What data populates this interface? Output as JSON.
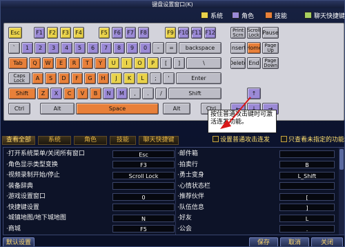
{
  "window": {
    "title": "键盘设置窗口(K)"
  },
  "legend": [
    {
      "label": "系统",
      "color": "#e9d24a"
    },
    {
      "label": "角色",
      "color": "#9b8ad6"
    },
    {
      "label": "技能",
      "color": "#e8803a"
    },
    {
      "label": "聊天快捷键",
      "color": "#a8d060"
    }
  ],
  "keys": [
    {
      "label": "Esc",
      "cat": "sys",
      "row": 0
    },
    {
      "label": "F1",
      "cat": "role",
      "row": 0
    },
    {
      "label": "F2",
      "cat": "sys",
      "row": 0
    },
    {
      "label": "F3",
      "cat": "sys",
      "row": 0
    },
    {
      "label": "F4",
      "cat": "sys",
      "row": 0
    },
    {
      "label": "F5",
      "cat": "sys",
      "row": 0
    },
    {
      "label": "F6",
      "cat": "role",
      "row": 0
    },
    {
      "label": "F7",
      "cat": "role",
      "row": 0
    },
    {
      "label": "F8",
      "cat": "role",
      "row": 0
    },
    {
      "label": "F9",
      "cat": "sys",
      "row": 0
    },
    {
      "label": "F10",
      "cat": "role",
      "row": 0
    },
    {
      "label": "F11",
      "cat": "role",
      "row": 0
    },
    {
      "label": "F12",
      "cat": "role",
      "row": 0
    },
    {
      "label": "Print\nScrn",
      "cat": "none",
      "row": 0
    },
    {
      "label": "Scroll\nLock",
      "cat": "none",
      "row": 0
    },
    {
      "label": "Pause",
      "cat": "none",
      "row": 0
    },
    {
      "label": "`",
      "cat": "none",
      "row": 1
    },
    {
      "label": "1",
      "cat": "role",
      "row": 1
    },
    {
      "label": "2",
      "cat": "role",
      "row": 1
    },
    {
      "label": "3",
      "cat": "role",
      "row": 1
    },
    {
      "label": "4",
      "cat": "role",
      "row": 1
    },
    {
      "label": "5",
      "cat": "role",
      "row": 1
    },
    {
      "label": "6",
      "cat": "role",
      "row": 1
    },
    {
      "label": "7",
      "cat": "role",
      "row": 1
    },
    {
      "label": "8",
      "cat": "role",
      "row": 1
    },
    {
      "label": "9",
      "cat": "role",
      "row": 1
    },
    {
      "label": "0",
      "cat": "role",
      "row": 1
    },
    {
      "label": "-",
      "cat": "none",
      "row": 1
    },
    {
      "label": "=",
      "cat": "none",
      "row": 1
    },
    {
      "label": "backspace",
      "cat": "none",
      "row": 1
    },
    {
      "label": "Insert",
      "cat": "none",
      "row": 1
    },
    {
      "label": "Home",
      "cat": "skill",
      "row": 1
    },
    {
      "label": "Page\nUp",
      "cat": "none",
      "row": 1
    },
    {
      "label": "Tab",
      "cat": "skill",
      "row": 2
    },
    {
      "label": "Q",
      "cat": "skill",
      "row": 2
    },
    {
      "label": "W",
      "cat": "skill",
      "row": 2
    },
    {
      "label": "E",
      "cat": "skill",
      "row": 2
    },
    {
      "label": "R",
      "cat": "skill",
      "row": 2
    },
    {
      "label": "T",
      "cat": "skill",
      "row": 2
    },
    {
      "label": "Y",
      "cat": "skill",
      "row": 2
    },
    {
      "label": "U",
      "cat": "sys",
      "row": 2
    },
    {
      "label": "I",
      "cat": "sys",
      "row": 2
    },
    {
      "label": "O",
      "cat": "sys",
      "row": 2
    },
    {
      "label": "P",
      "cat": "sys",
      "row": 2
    },
    {
      "label": "[",
      "cat": "none",
      "row": 2
    },
    {
      "label": "]",
      "cat": "none",
      "row": 2
    },
    {
      "label": "\\",
      "cat": "none",
      "row": 2
    },
    {
      "label": "Delete",
      "cat": "none",
      "row": 2
    },
    {
      "label": "End",
      "cat": "none",
      "row": 2
    },
    {
      "label": "Page\nDown",
      "cat": "none",
      "row": 2
    },
    {
      "label": "Caps\nLock",
      "cat": "none",
      "row": 3
    },
    {
      "label": "A",
      "cat": "skill",
      "row": 3
    },
    {
      "label": "S",
      "cat": "skill",
      "row": 3
    },
    {
      "label": "D",
      "cat": "skill",
      "row": 3
    },
    {
      "label": "F",
      "cat": "skill",
      "row": 3
    },
    {
      "label": "G",
      "cat": "skill",
      "row": 3
    },
    {
      "label": "H",
      "cat": "skill",
      "row": 3
    },
    {
      "label": "J",
      "cat": "sys",
      "row": 3
    },
    {
      "label": "K",
      "cat": "sys",
      "row": 3
    },
    {
      "label": "L",
      "cat": "sys",
      "row": 3
    },
    {
      "label": ";",
      "cat": "none",
      "row": 3
    },
    {
      "label": "'",
      "cat": "none",
      "row": 3
    },
    {
      "label": "Enter",
      "cat": "none",
      "row": 3
    },
    {
      "label": "Shift",
      "cat": "skill",
      "row": 4
    },
    {
      "label": "Z",
      "cat": "skill",
      "row": 4
    },
    {
      "label": "X",
      "cat": "role",
      "row": 4
    },
    {
      "label": "C",
      "cat": "skill",
      "row": 4
    },
    {
      "label": "V",
      "cat": "skill",
      "row": 4
    },
    {
      "label": "B",
      "cat": "skill",
      "row": 4
    },
    {
      "label": "N",
      "cat": "role",
      "row": 4
    },
    {
      "label": "M",
      "cat": "role",
      "row": 4
    },
    {
      "label": ",",
      "cat": "none",
      "row": 4
    },
    {
      "label": ".",
      "cat": "none",
      "row": 4
    },
    {
      "label": "/",
      "cat": "none",
      "row": 4
    },
    {
      "label": "Shift",
      "cat": "none",
      "row": 4
    },
    {
      "label": "↑",
      "cat": "role",
      "row": 4
    },
    {
      "label": "Ctrl",
      "cat": "none",
      "row": 5
    },
    {
      "label": "Alt",
      "cat": "none",
      "row": 5
    },
    {
      "label": "Space",
      "cat": "skill",
      "row": 5
    },
    {
      "label": "Alt",
      "cat": "none",
      "row": 5
    },
    {
      "label": "Ctrl",
      "cat": "none",
      "row": 5
    },
    {
      "label": "←",
      "cat": "role",
      "row": 5
    },
    {
      "label": "↓",
      "cat": "role",
      "row": 5
    },
    {
      "label": "→",
      "cat": "role",
      "row": 5
    }
  ],
  "callout": {
    "text": "按住普通攻击键时可激活连发功能。"
  },
  "tabs": [
    {
      "label": "查看全部",
      "active": true
    },
    {
      "label": "系统"
    },
    {
      "label": "角色"
    },
    {
      "label": "技能"
    },
    {
      "label": "聊天快捷键"
    }
  ],
  "options": {
    "auto_attack": "设置普通攻击连发",
    "show_unassigned": "只查看未指定的功能"
  },
  "bindings_left": [
    {
      "name": "打开系统菜单/关闭所有窗口",
      "key": "Esc"
    },
    {
      "name": "角色显示类型变换",
      "key": "F3"
    },
    {
      "name": "视频录制开始/停止",
      "key": "Scroll Lock"
    },
    {
      "name": "装备辞典",
      "key": ""
    },
    {
      "name": "游戏设置窗口",
      "key": "0"
    },
    {
      "name": "快捷键设置",
      "key": ""
    },
    {
      "name": "城镇地图/地下城地图",
      "key": "N"
    },
    {
      "name": "商城",
      "key": "F5"
    }
  ],
  "bindings_right": [
    {
      "name": "邮件箱",
      "key": ""
    },
    {
      "name": "拍卖行",
      "key": "B"
    },
    {
      "name": "勇士变身",
      "key": "L_Shift"
    },
    {
      "name": "心情状态栏",
      "key": ""
    },
    {
      "name": "推荐伙伴",
      "key": "["
    },
    {
      "name": "队伍信息",
      "key": "]"
    },
    {
      "name": "好友",
      "key": "L"
    },
    {
      "name": "公会",
      "key": "."
    }
  ],
  "buttons": {
    "default": "默认设置",
    "save": "保存",
    "cancel": "取消",
    "close": "关闭"
  }
}
